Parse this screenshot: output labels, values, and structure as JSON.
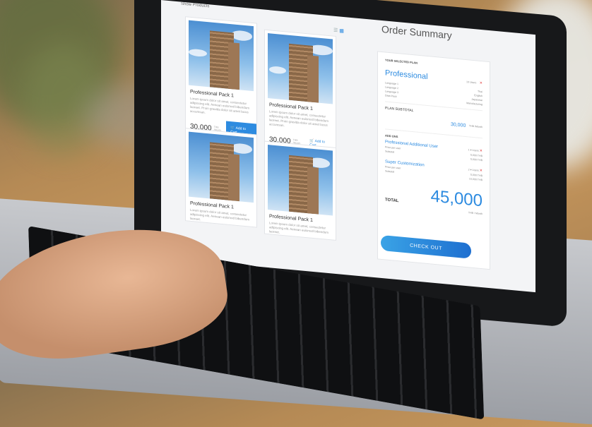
{
  "header": {
    "show_products": "Show Products",
    "list_icon": "list-view-icon",
    "grid_icon": "grid-view-icon"
  },
  "products": [
    {
      "title": "Professional Pack 1",
      "desc": "Lorem ipsum dolor sit amet, consectetur adipiscing elit. Aenean euismod bibendum laoreet. Proin gravida dolor sit amet lacus accumsan.",
      "price": "30,000",
      "per": "THB /Month",
      "action": "Add to Cart",
      "primary": true
    },
    {
      "title": "Professional Pack 1",
      "desc": "Lorem ipsum dolor sit amet, consectetur adipiscing elit. Aenean euismod bibendum laoreet. Proin gravida dolor sit amet lacus accumsan.",
      "price": "30,000",
      "per": "THB /Month",
      "action": "Add to Cart",
      "primary": false
    },
    {
      "title": "Professional Pack 1",
      "desc": "Lorem ipsum dolor sit amet, consectetur adipiscing elit. Aenean euismod bibendum laoreet.",
      "price": "",
      "per": "",
      "action": "",
      "primary": false
    },
    {
      "title": "Professional Pack 1",
      "desc": "Lorem ipsum dolor sit amet, consectetur adipiscing elit. Aenean euismod bibendum laoreet.",
      "price": "",
      "per": "",
      "action": "",
      "primary": false
    }
  ],
  "summary": {
    "title": "Order Summary",
    "selected_plan_heading": "YOUR SELECTED PLAN",
    "plan_name": "Professional",
    "users": "10 Users",
    "languages": [
      {
        "label": "Language 1",
        "value": "Thai"
      },
      {
        "label": "Language 2",
        "value": "English"
      },
      {
        "label": "Language 3",
        "value": "Japanese"
      }
    ],
    "data_pack": {
      "label": "Data Pack",
      "value": "Manufacturing"
    },
    "subtotal_label": "PLAN SUBTOTAL",
    "subtotal_value": "30,000",
    "subtotal_unit": "THB /Month",
    "addons_heading": "ADD ONS",
    "addons": [
      {
        "name": "Professional Additional User",
        "qty": "1",
        "unit": "Users",
        "price_label": "Price per user",
        "price": "5,000 THB",
        "subtotal_label": "Subtotal",
        "subtotal": "5,000 THB"
      },
      {
        "name": "Super Customization",
        "qty": "2",
        "unit": "Users",
        "price_label": "Price per user",
        "price": "5,000 THB",
        "subtotal_label": "Subtotal",
        "subtotal": "10,000 THB"
      }
    ],
    "total_label": "TOTAL",
    "total_value": "45,000",
    "total_unit": "THB / Month",
    "checkout": "CHECK OUT"
  },
  "colors": {
    "accent": "#2d8be0",
    "remove": "#e03c3c"
  }
}
